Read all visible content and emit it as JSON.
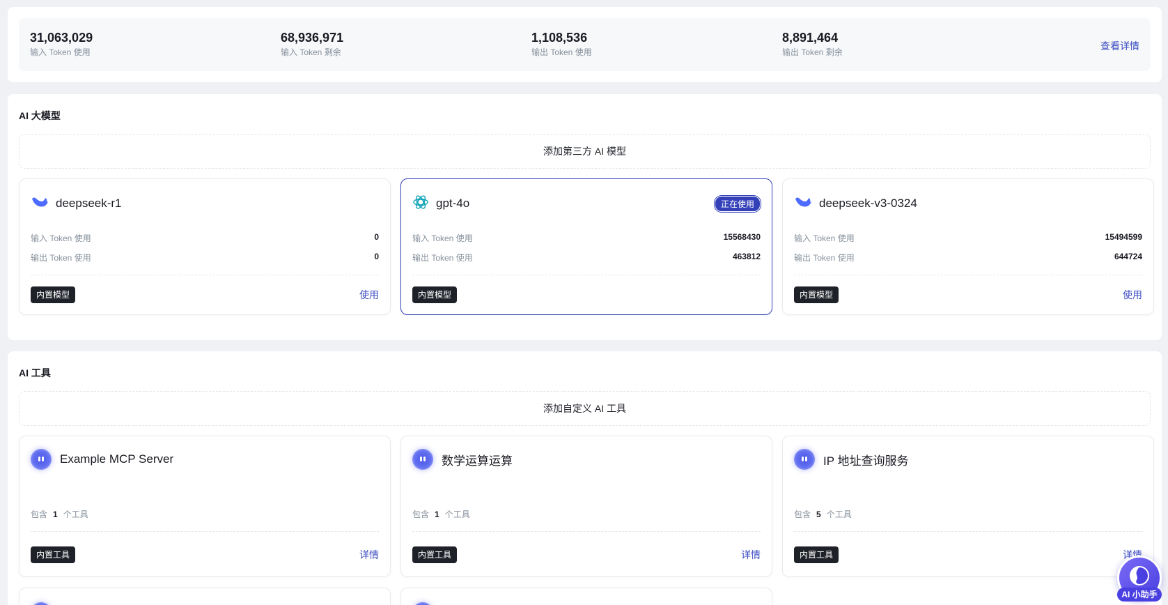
{
  "stats": {
    "items": [
      {
        "value": "31,063,029",
        "label": "输入 Token 使用"
      },
      {
        "value": "68,936,971",
        "label": "输入 Token 剩余"
      },
      {
        "value": "1,108,536",
        "label": "输出 Token 使用"
      },
      {
        "value": "8,891,464",
        "label": "输出 Token 剩余"
      }
    ],
    "detail_link": "查看详情"
  },
  "models": {
    "title": "AI 大模型",
    "add_label": "添加第三方 AI 模型",
    "cards": [
      {
        "name": "deepseek-r1",
        "icon": "deepseek-whale-icon",
        "input_label": "输入 Token 使用",
        "input_value": "0",
        "output_label": "输出 Token 使用",
        "output_value": "0",
        "tag": "内置模型",
        "action": "使用",
        "active": false
      },
      {
        "name": "gpt-4o",
        "icon": "openai-icon",
        "input_label": "输入 Token 使用",
        "input_value": "15568430",
        "output_label": "输出 Token 使用",
        "output_value": "463812",
        "tag": "内置模型",
        "badge": "正在使用",
        "active": true
      },
      {
        "name": "deepseek-v3-0324",
        "icon": "deepseek-whale-icon",
        "input_label": "输入 Token 使用",
        "input_value": "15494599",
        "output_label": "输出 Token 使用",
        "output_value": "644724",
        "tag": "内置模型",
        "action": "使用",
        "active": false
      }
    ]
  },
  "tools": {
    "title": "AI 工具",
    "add_label": "添加自定义 AI 工具",
    "cards": [
      {
        "name": "Example MCP Server",
        "count_prefix": "包含",
        "count": "1",
        "count_suffix": "个工具",
        "tag": "内置工具",
        "action": "详情"
      },
      {
        "name": "数学运算运算",
        "count_prefix": "包含",
        "count": "1",
        "count_suffix": "个工具",
        "tag": "内置工具",
        "action": "详情"
      },
      {
        "name": "IP 地址查询服务",
        "count_prefix": "包含",
        "count": "5",
        "count_suffix": "个工具",
        "tag": "内置工具",
        "action": "详情"
      }
    ]
  },
  "assistant": {
    "label": "AI 小助手"
  },
  "colors": {
    "accent": "#3340b8",
    "link": "#3b4cc2",
    "tag_bg": "#1f2129"
  }
}
